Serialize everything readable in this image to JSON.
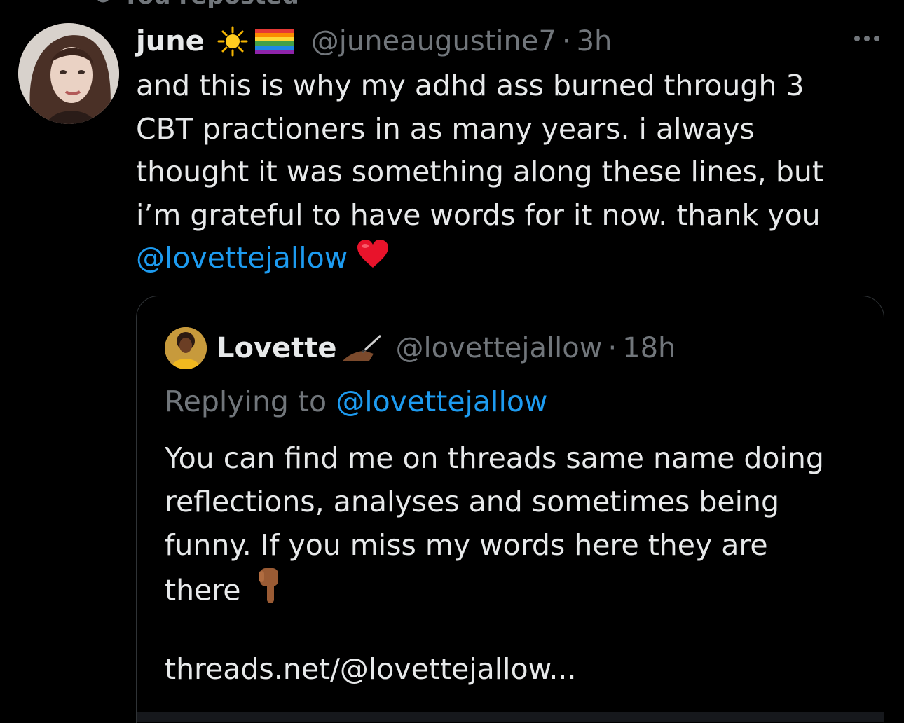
{
  "repost_bar": {
    "icon": "repost-icon",
    "label": "You reposted"
  },
  "tweet": {
    "author_name": "june",
    "author_emojis": [
      "sun-emoji",
      "rainbow-flag-emoji"
    ],
    "handle": "@juneaugustine7",
    "separator": "·",
    "time": "3h",
    "more_icon": "more-dots-icon",
    "lines": [
      "and this is why my adhd ass burned through 3",
      "CBT practioners in as many years. i always",
      "thought it was something along these lines, but",
      "i’m grateful to have words for it now. thank you"
    ],
    "mention": "@lovettejallow",
    "trailing_emoji": "red-heart-emoji"
  },
  "quoted": {
    "author_name": "Lovette",
    "author_emoji": "writing-hand-emoji",
    "handle": "@lovettejallow",
    "separator": "·",
    "time": "18h",
    "replying_prefix": "Replying to",
    "replying_mention": "@lovettejallow",
    "lines": [
      "You can find me on threads same name doing",
      "reflections, analyses and sometimes being",
      "funny. If you miss my words here they are",
      "there"
    ],
    "trailing_emoji": "pointing-down-emoji",
    "link": "threads.net/@lovettejallow..."
  },
  "colors": {
    "background": "#000000",
    "text_primary": "#e7e9ea",
    "text_secondary": "#71767b",
    "link": "#1d9bf0",
    "border": "#2f3336"
  }
}
